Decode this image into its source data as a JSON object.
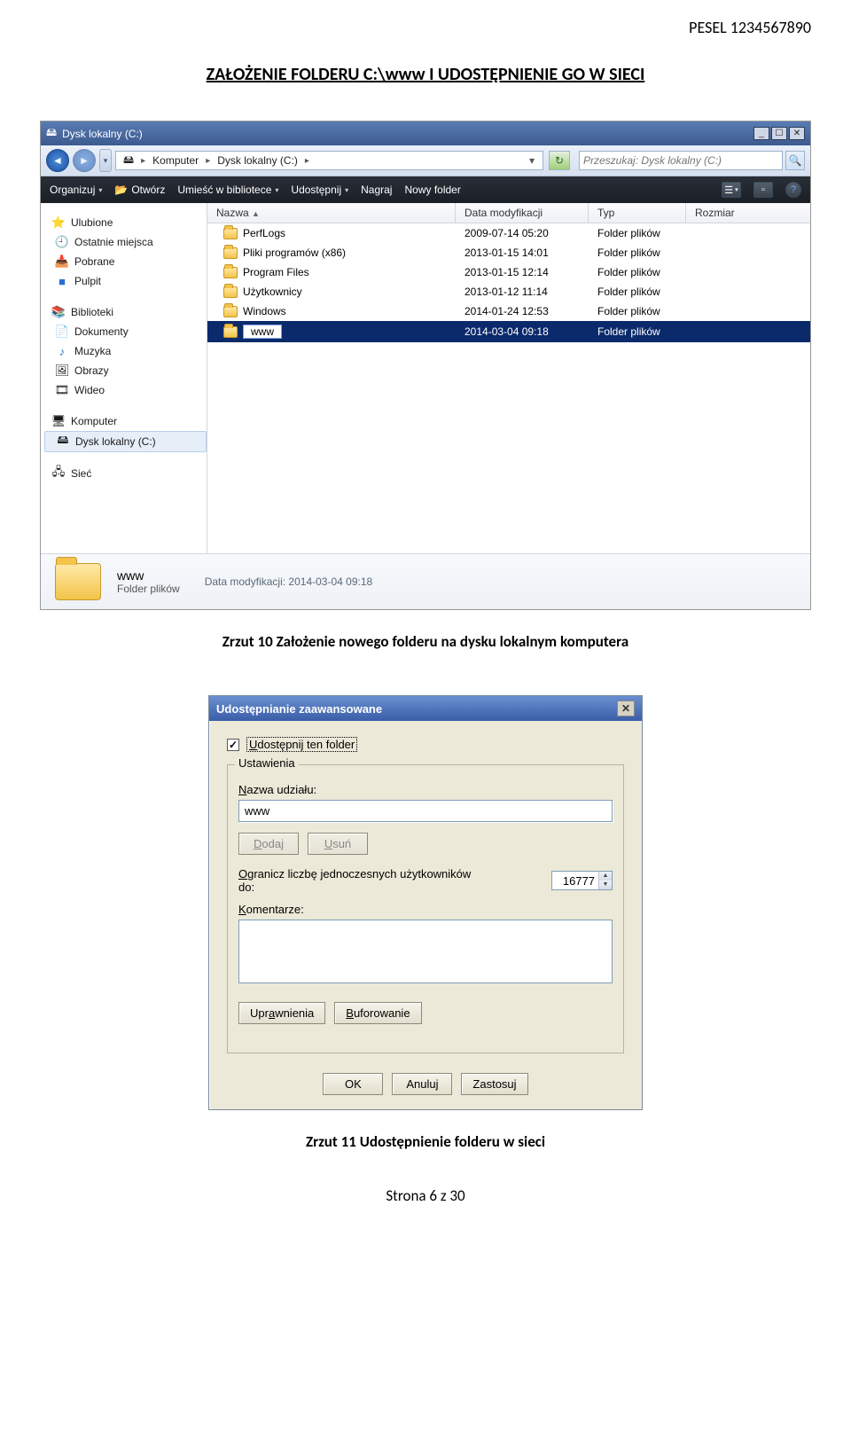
{
  "header": {
    "pesel_label": "PESEL  1234567890",
    "section_title": "ZAŁOŻENIE FOLDERU C:\\www I UDOSTĘPNIENIE GO W SIECI"
  },
  "explorer": {
    "window_title": "Dysk lokalny (C:)",
    "breadcrumb": {
      "seg1": "Komputer",
      "seg2": "Dysk lokalny (C:)"
    },
    "search_placeholder": "Przeszukaj: Dysk lokalny (C:)",
    "toolbar": {
      "organize": "Organizuj",
      "open": "Otwórz",
      "library": "Umieść w bibliotece",
      "share": "Udostępnij",
      "burn": "Nagraj",
      "newfolder": "Nowy folder"
    },
    "sidebar_favorites_header": "Ulubione",
    "sidebar_favorites": [
      {
        "label": "Ostatnie miejsca"
      },
      {
        "label": "Pobrane"
      },
      {
        "label": "Pulpit"
      }
    ],
    "sidebar_libraries_header": "Biblioteki",
    "sidebar_libraries": [
      {
        "label": "Dokumenty"
      },
      {
        "label": "Muzyka"
      },
      {
        "label": "Obrazy"
      },
      {
        "label": "Wideo"
      }
    ],
    "sidebar_computer_header": "Komputer",
    "sidebar_drive": "Dysk lokalny (C:)",
    "sidebar_network_header": "Sieć",
    "columns": {
      "name": "Nazwa",
      "date": "Data modyfikacji",
      "type": "Typ",
      "size": "Rozmiar"
    },
    "rows": [
      {
        "name": "PerfLogs",
        "date": "2009-07-14 05:20",
        "type": "Folder plików"
      },
      {
        "name": "Pliki programów (x86)",
        "date": "2013-01-15 14:01",
        "type": "Folder plików"
      },
      {
        "name": "Program Files",
        "date": "2013-01-15 12:14",
        "type": "Folder plików"
      },
      {
        "name": "Użytkownicy",
        "date": "2013-01-12 11:14",
        "type": "Folder plików"
      },
      {
        "name": "Windows",
        "date": "2014-01-24 12:53",
        "type": "Folder plików"
      },
      {
        "name": "www",
        "date": "2014-03-04 09:18",
        "type": "Folder plików"
      }
    ],
    "details": {
      "name": "www",
      "type": "Folder plików",
      "meta_label": "Data modyfikacji:",
      "meta_value": "2014-03-04 09:18"
    }
  },
  "caption1": "Zrzut 10 Założenie nowego folderu na dysku lokalnym komputera",
  "dialog": {
    "title": "Udostępnianie zaawansowane",
    "share_checkbox_label": "Udostępnij ten folder",
    "group_legend": "Ustawienia",
    "share_name_label": "Nazwa udziału:",
    "share_name_value": "www",
    "add_btn": "Dodaj",
    "remove_btn": "Usuń",
    "limit_label_line1": "Ogranicz liczbę jednoczesnych użytkowników",
    "limit_label_line2": "do:",
    "limit_value": "16777",
    "comments_label": "Komentarze:",
    "comments_value": "",
    "perm_btn": "Uprawnienia",
    "cache_btn": "Buforowanie",
    "ok_btn": "OK",
    "cancel_btn": "Anuluj",
    "apply_btn": "Zastosuj"
  },
  "caption2": "Zrzut 11 Udostępnienie folderu w sieci",
  "footer": {
    "text": "Strona 6 z 30"
  }
}
